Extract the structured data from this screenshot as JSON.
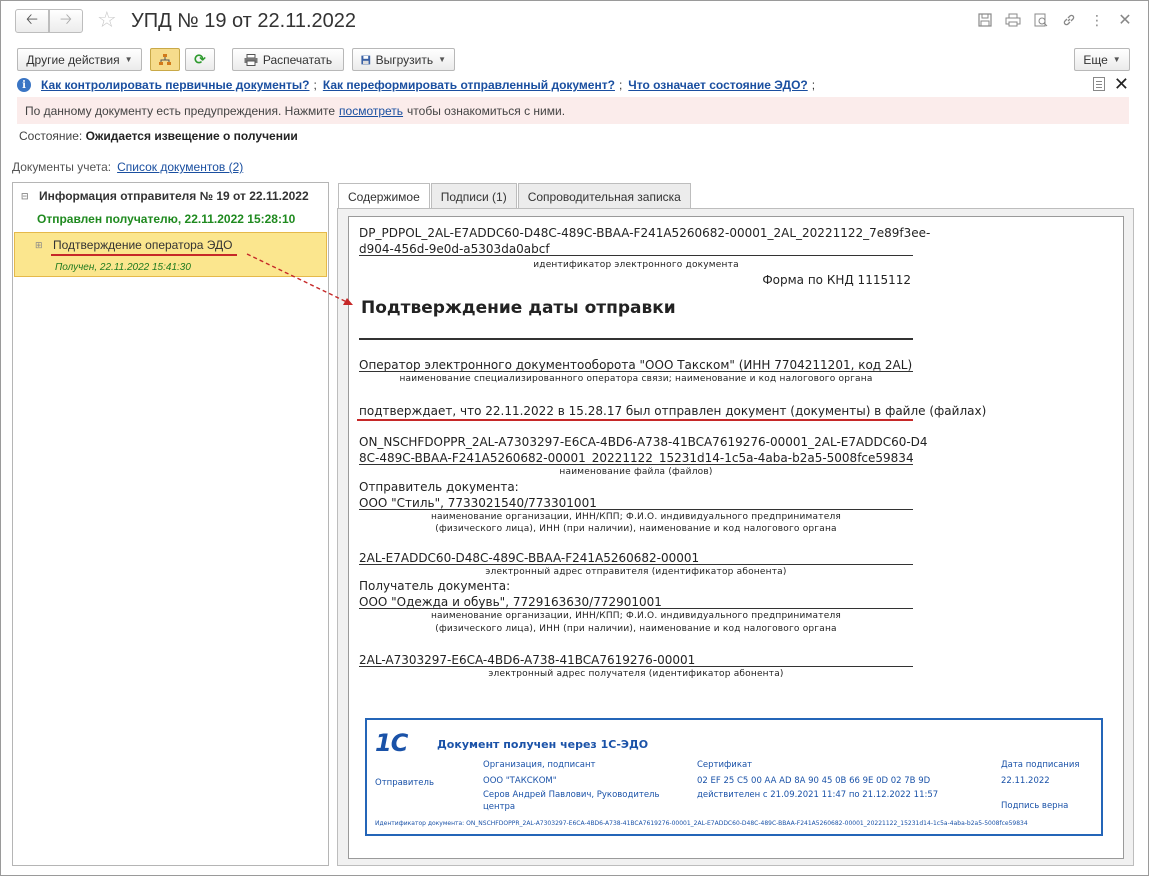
{
  "titlebar": {
    "title": "УПД № 19 от 22.11.2022",
    "icons": [
      "back-arrow",
      "forward-arrow",
      "star",
      "save",
      "print",
      "preview",
      "link",
      "more",
      "close"
    ]
  },
  "toolbar": {
    "other_actions": "Другие действия",
    "print": "Распечатать",
    "export": "Выгрузить",
    "more": "Еще"
  },
  "help": {
    "link1": "Как контролировать первичные документы?",
    "sep1": ";",
    "link2": "Как переформировать отправленный документ?",
    "sep2": ";",
    "link3": "Что означает состояние ЭДО?",
    "sep3": ";"
  },
  "warning": {
    "before": "По данному документу есть предупреждения. Нажмите",
    "link": "посмотреть",
    "after": "чтобы ознакомиться с ними."
  },
  "status": {
    "label": "Состояние:",
    "value": "Ожидается извещение о получении"
  },
  "accounting_docs": {
    "label": "Документы учета:",
    "link": "Список документов (2)"
  },
  "tree": {
    "root": "Информация отправителя № 19 от 22.11.2022",
    "sent": "Отправлен получателю, 22.11.2022 15:28:10",
    "child": "Подтверждение оператора ЭДО",
    "received": "Получен, 22.11.2022 15:41:30"
  },
  "tabs": [
    {
      "label": "Содержимое",
      "active": true
    },
    {
      "label": "Подписи (1)",
      "active": false
    },
    {
      "label": "Сопроводительная записка",
      "active": false
    }
  ],
  "document": {
    "id_line1": "DP_PDPOL_2AL-E7ADDC60-D48C-489C-BBAA-F241A5260682-00001_2AL_20221122_7e89f3ee-",
    "id_line2": "d904-456d-9e0d-a5303da0abcf",
    "id_caption": "идентификатор электронного документа",
    "form": "Форма по КНД 1115112",
    "heading": "Подтверждение даты отправки",
    "operator": "Оператор электронного документооборота \"ООО Такском\" (ИНН 7704211201, код 2AL)",
    "operator_caption": "наименование специализированного оператора связи; наименование и код налогового органа",
    "confirms": "подтверждает, что 22.11.2022 в 15.28.17 был отправлен документ (документы) в файле (файлах)",
    "file_line1": "ON_NSCHFDOPPR_2AL-A7303297-E6CA-4BD6-A738-41BCA7619276-00001_2AL-E7ADDC60-D4",
    "file_line2": "8C-489C-BBAA-F241A5260682-00001_20221122_15231d14-1c5a-4aba-b2a5-5008fce59834",
    "file_caption": "наименование файла (файлов)",
    "sender_label": "Отправитель документа:",
    "sender": "ООО \"Стиль\", 7733021540/773301001",
    "org_caption1": "наименование организации, ИНН/КПП; Ф.И.О. индивидуального предпринимателя",
    "org_caption2": "(физического лица), ИНН (при наличии), наименование и код налогового органа",
    "sender_address": "2AL-E7ADDC60-D48C-489C-BBAA-F241A5260682-00001",
    "sender_address_caption": "электронный адрес отправителя (идентификатор абонента)",
    "recipient_label": "Получатель документа:",
    "recipient": "ООО \"Одежда и обувь\", 7729163630/772901001",
    "org_caption3": "наименование организации, ИНН/КПП; Ф.И.О. индивидуального предпринимателя",
    "org_caption4": "(физического лица), ИНН (при наличии), наименование и код налогового органа",
    "recipient_address": "2AL-A7303297-E6CA-4BD6-A738-41BCA7619276-00001",
    "recipient_address_caption": "электронный адрес получателя (идентификатор абонента)"
  },
  "stamp": {
    "logo": "1С",
    "title": "Документ получен через 1С-ЭДО",
    "col_org": "Организация, подписант",
    "col_cert": "Сертификат",
    "col_date": "Дата подписания",
    "row_role": "Отправитель",
    "org": "ООО \"ТАКСКОМ\"",
    "signer1": "Серов Андрей Павлович, Руководитель",
    "signer2": "центра",
    "cert": "02 EF 25 C5 00 AA AD 8A 90 45 0B 66 9E 0D 02 7B 9D",
    "valid": "действителен с 21.09.2021 11:47 по 21.12.2022 11:57",
    "date": "22.11.2022",
    "verified": "Подпись верна",
    "doc_id": "Идентификатор документа: ON_NSCHFDOPPR_2AL-A7303297-E6CA-4BD6-A738-41BCA7619276-00001_2AL-E7ADDC60-D48C-489C-BBAA-F241A5260682-00001_20221122_15231d14-1c5a-4aba-b2a5-5008fce59834"
  }
}
